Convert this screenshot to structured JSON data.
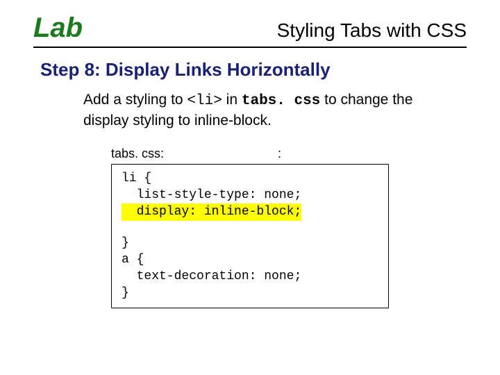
{
  "header": {
    "lab": "Lab",
    "title": "Styling Tabs with CSS"
  },
  "step_heading": "Step 8:  Display Links Horizontally",
  "body": {
    "pre": "Add a styling to ",
    "code1": "<li>",
    "mid1": " in ",
    "file": "tabs. css",
    "post": " to change the display styling to inline-block."
  },
  "labels": {
    "left": "tabs. css:",
    "right": ":"
  },
  "code": {
    "l1": "li {",
    "l2": "  list-style-type: none;",
    "l3": "  display: inline-block;",
    "l4": "}",
    "l5": "a {",
    "l6": "  text-decoration: none;",
    "l7": "}"
  }
}
